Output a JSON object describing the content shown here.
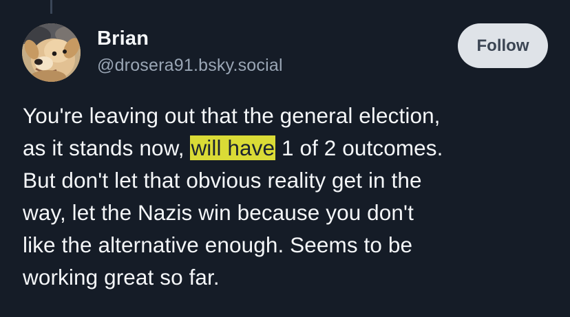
{
  "post": {
    "author": {
      "display_name": "Brian",
      "handle": "@drosera91.bsky.social",
      "avatar_icon": "dog-avatar"
    },
    "follow_label": "Follow",
    "text_lines": [
      {
        "text": "You're leaving out that the general election,"
      },
      {
        "before": "as it stands now, ",
        "highlight": "will have",
        "after": " 1 of 2 outcomes."
      },
      {
        "text": "But don't let that obvious reality get in the"
      },
      {
        "text": "way, let the Nazis win because you don't"
      },
      {
        "text": "like the alternative enough. Seems to be"
      },
      {
        "text": "working great so far."
      }
    ]
  },
  "colors": {
    "background": "#151c27",
    "text": "#f4f6f8",
    "handle": "#9aa6b5",
    "follow_button_bg": "#dfe3e8",
    "follow_button_text": "#3b4553",
    "highlight": "#ecec37"
  }
}
